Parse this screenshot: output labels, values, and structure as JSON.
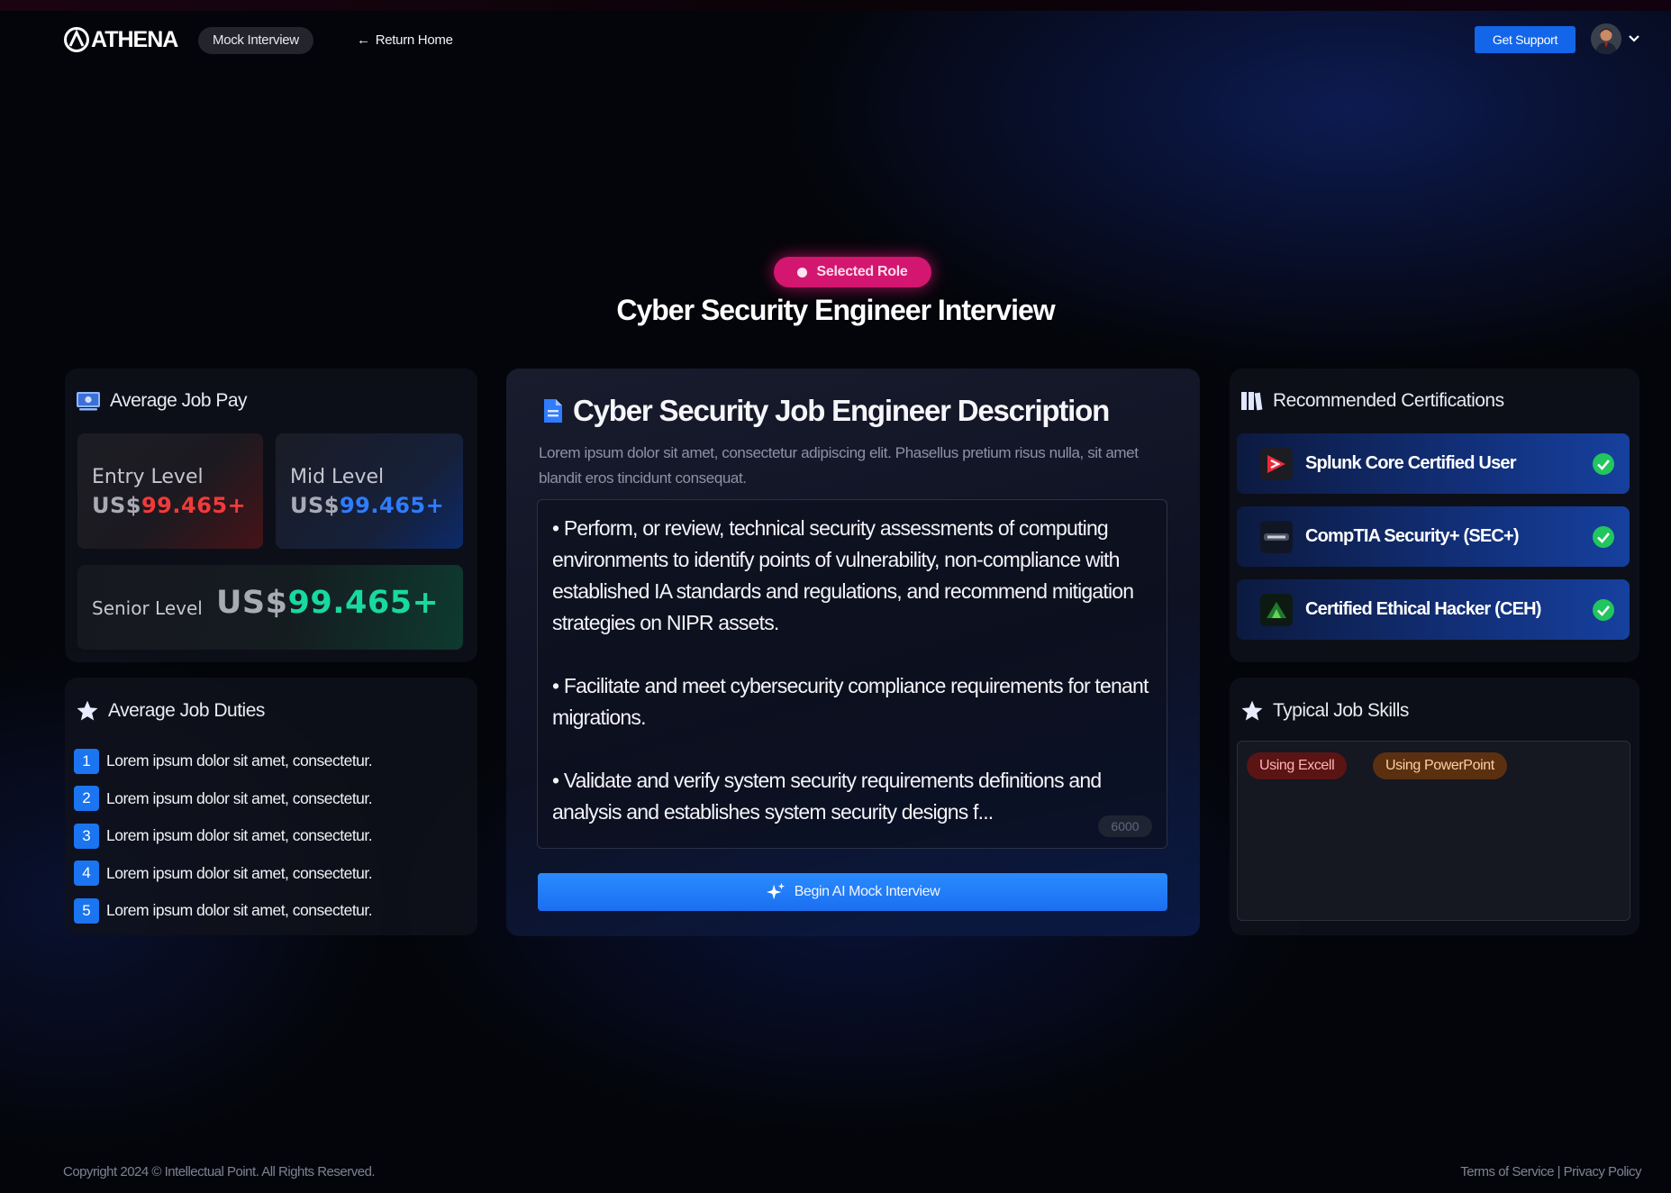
{
  "header": {
    "logo_text": "ATHENA",
    "nav_active": "Mock Interview",
    "return_label": "Return Home",
    "support_label": "Get Support"
  },
  "hero": {
    "badge": "Selected Role",
    "title": "Cyber Security Engineer Interview"
  },
  "pay": {
    "title": "Average Job Pay",
    "entry": {
      "label": "Entry Level",
      "currency": "US$",
      "amount": "99.465+"
    },
    "mid": {
      "label": "Mid Level",
      "currency": "US$",
      "amount": "99.465+"
    },
    "senior": {
      "label": "Senior Level",
      "currency": "US$",
      "amount": "99.465+"
    }
  },
  "duties": {
    "title": "Average Job Duties",
    "items": [
      {
        "num": "1",
        "text": "Lorem ipsum dolor sit amet, consectetur."
      },
      {
        "num": "2",
        "text": "Lorem ipsum dolor sit amet, consectetur."
      },
      {
        "num": "3",
        "text": "Lorem ipsum dolor sit amet, consectetur."
      },
      {
        "num": "4",
        "text": "Lorem ipsum dolor sit amet, consectetur."
      },
      {
        "num": "5",
        "text": "Lorem ipsum dolor sit amet, consectetur."
      }
    ]
  },
  "description": {
    "title": "Cyber Security Job Engineer Description",
    "subtitle": "Lorem ipsum dolor sit amet, consectetur adipiscing elit. Phasellus pretium risus nulla, sit amet blandit eros tincidunt consequat.",
    "paragraphs": [
      "• Perform, or review, technical security assessments of computing environments to identify points of vulnerability, non-compliance with established IA standards and regulations, and recommend mitigation strategies on NIPR assets.",
      "• Facilitate and meet cybersecurity compliance requirements for tenant migrations.",
      "• Validate and verify system security requirements definitions and analysis and establishes system security designs f..."
    ],
    "char_count": "6000",
    "begin_label": "Begin AI Mock Interview"
  },
  "certifications": {
    "title": "Recommended Certifications",
    "items": [
      {
        "name": "Splunk Core Certified User",
        "icon": "splunk-logo"
      },
      {
        "name": "CompTIA Security+ (SEC+)",
        "icon": "comptia-logo"
      },
      {
        "name": "Certified Ethical Hacker (CEH)",
        "icon": "ceh-logo"
      }
    ],
    "check_color": "#22c55e"
  },
  "skills": {
    "title": "Typical Job Skills",
    "tags": [
      "Using Excell",
      "Using PowerPoint"
    ]
  },
  "footer": {
    "copyright": "Copyright 2024 © Intellectual Point. All Rights Reserved.",
    "links": "Terms of Service | Privacy Policy"
  },
  "colors": {
    "accent_blue": "#1b6ff0",
    "badge_pink": "#d31670",
    "pay_red": "#f23a3a",
    "pay_blue": "#2f7cff",
    "pay_green": "#18d9a0"
  }
}
